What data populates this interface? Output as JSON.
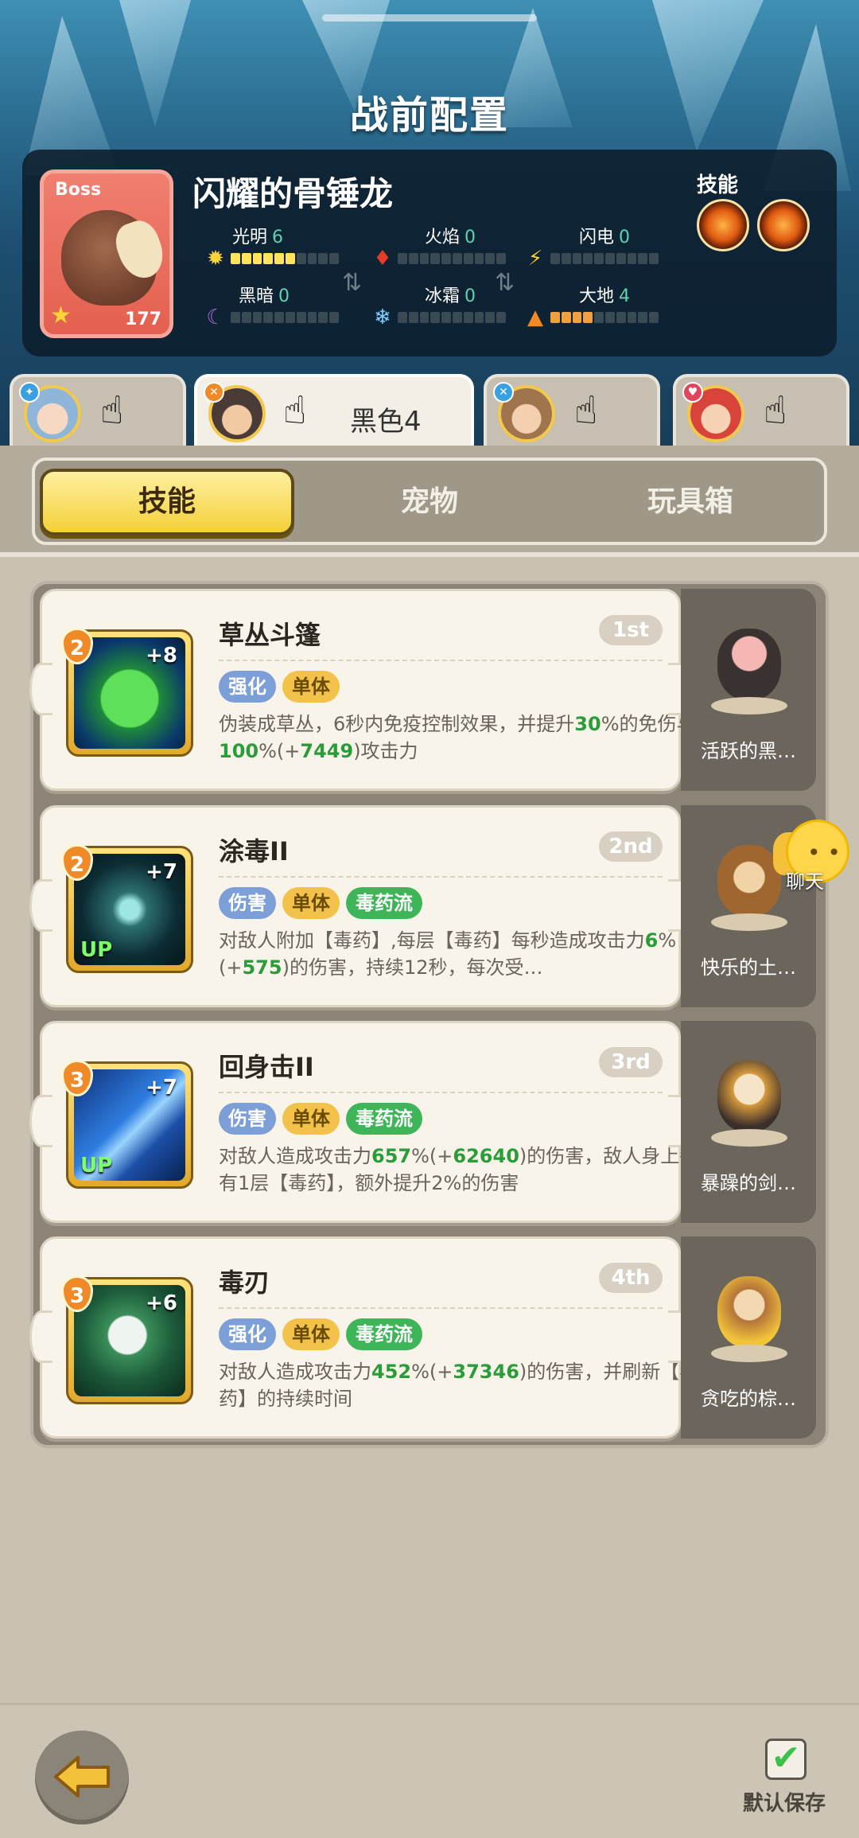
{
  "page_title": "战前配置",
  "boss": {
    "tag": "Boss",
    "name": "闪耀的骨锤龙",
    "level": "177",
    "skills_label": "技能",
    "elements": [
      {
        "name": "光明",
        "value": "6",
        "level": 6,
        "icon": "sun-icon"
      },
      {
        "name": "火焰",
        "value": "0",
        "level": 0,
        "icon": "flame-icon"
      },
      {
        "name": "闪电",
        "value": "0",
        "level": 0,
        "icon": "lightning-icon"
      },
      {
        "name": "黑暗",
        "value": "0",
        "level": 0,
        "icon": "moon-icon"
      },
      {
        "name": "冰霜",
        "value": "0",
        "level": 0,
        "icon": "snowflake-icon"
      },
      {
        "name": "大地",
        "value": "4",
        "level": 4,
        "icon": "mountain-icon"
      }
    ]
  },
  "heroes": [
    {
      "name": ""
    },
    {
      "name": "黑色4"
    },
    {
      "name": ""
    },
    {
      "name": ""
    }
  ],
  "tabs": [
    "技能",
    "宠物",
    "玩具箱"
  ],
  "skills": [
    {
      "level": "2",
      "plus": "+8",
      "up": "",
      "title": "草丛斗篷",
      "rank": "1st",
      "tags": [
        "强化",
        "单体"
      ],
      "desc_parts": [
        "伪装成草丛，6秒内免疫控制效果，并提升",
        "30",
        "%的免伤与",
        "100",
        "%(+",
        "7449",
        ")攻击力"
      ]
    },
    {
      "level": "2",
      "plus": "+7",
      "up": "UP",
      "title": "涂毒II",
      "rank": "2nd",
      "tags": [
        "伤害",
        "单体",
        "毒药流"
      ],
      "desc_parts": [
        "对敌人附加【毒药】,每层【毒药】每秒造成攻击力",
        "6",
        "%(+",
        "575",
        ")的伤害，持续12秒，每次受…",
        "",
        "",
        "",
        ""
      ]
    },
    {
      "level": "3",
      "plus": "+7",
      "up": "UP",
      "title": "回身击II",
      "rank": "3rd",
      "tags": [
        "伤害",
        "单体",
        "毒药流"
      ],
      "desc_parts": [
        "对敌人造成攻击力",
        "657",
        "%(+",
        "62640",
        ")的伤害，敌人身上每有1层【毒药】，额外提升2%的伤害",
        "",
        "",
        "",
        ""
      ]
    },
    {
      "level": "3",
      "plus": "+6",
      "up": "",
      "title": "毒刃",
      "rank": "4th",
      "tags": [
        "强化",
        "单体",
        "毒药流"
      ],
      "desc_parts": [
        "对敌人造成攻击力",
        "452",
        "%(+",
        "37346",
        ")的伤害，并刷新【毒药】的持续时间",
        "",
        "",
        "",
        ""
      ]
    }
  ],
  "pets": [
    "活跃的黑…",
    "快乐的土…",
    "暴躁的剑…",
    "贪吃的棕…"
  ],
  "chat_label": "聊天",
  "save_label": "默认保存",
  "colors": {
    "accent_green": "#2a9d3a",
    "tab_active": "#f4d038",
    "tag_blue": "#7b9fd6",
    "tag_yellow": "#f2c24a",
    "tag_green": "#3fb55a"
  }
}
